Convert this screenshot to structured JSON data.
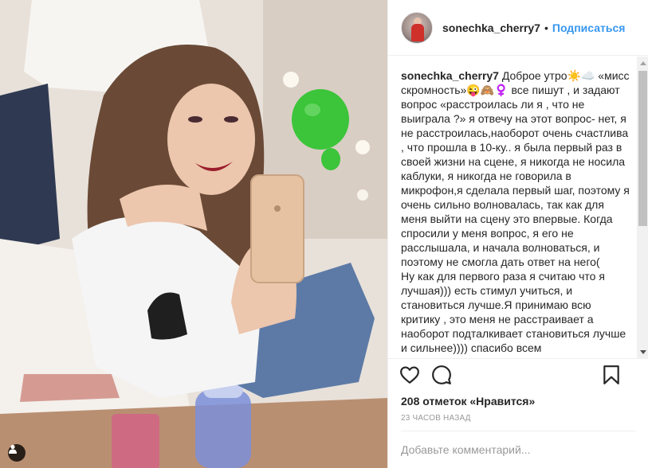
{
  "post": {
    "username": "sonechka_cherry7",
    "separator": "•",
    "follow_label": "Подписаться",
    "caption_author": "sonechka_cherry7",
    "caption_text": " Доброе утро☀️☁️ «мисс скромность»😜🙈♀️ все пишут , и задают вопрос «расстроилась ли я , что не выиграла ?» я отвечу на этот вопрос- нет, я не расстроилась,наоборот очень счастлива , что прошла в 10-ку.. я была первый раз в своей жизни на сцене, я никогда не носила каблуки, я никогда не говорила в микрофон,я сделала первый шаг, поэтому я очень сильно волновалась, так как для меня выйти на сцену это впервые. Когда спросили у меня вопрос, я его не расслышала, и начала волноваться, и поэтому не смогла дать ответ на него(\nНу как для первого раза я считаю что я лучшая))) есть стимул учиться, и становиться лучше.Я принимаю всю критику , это меня не расстраивает а наоборот подталкивает становиться лучше и сильнее)))) спасибо всем",
    "likes_text": "208 отметок «Нравится»",
    "time_text": "23 ЧАСОВ НАЗАД",
    "comment_placeholder": "Добавьте комментарий..."
  },
  "icons": {
    "like": "heart-outline-icon",
    "comment": "speech-bubble-icon",
    "save": "bookmark-icon",
    "photo_badge": "person-tag-icon"
  },
  "colors": {
    "accent": "#3897f0",
    "text": "#262626",
    "muted": "#999999",
    "divider": "#efefef"
  }
}
